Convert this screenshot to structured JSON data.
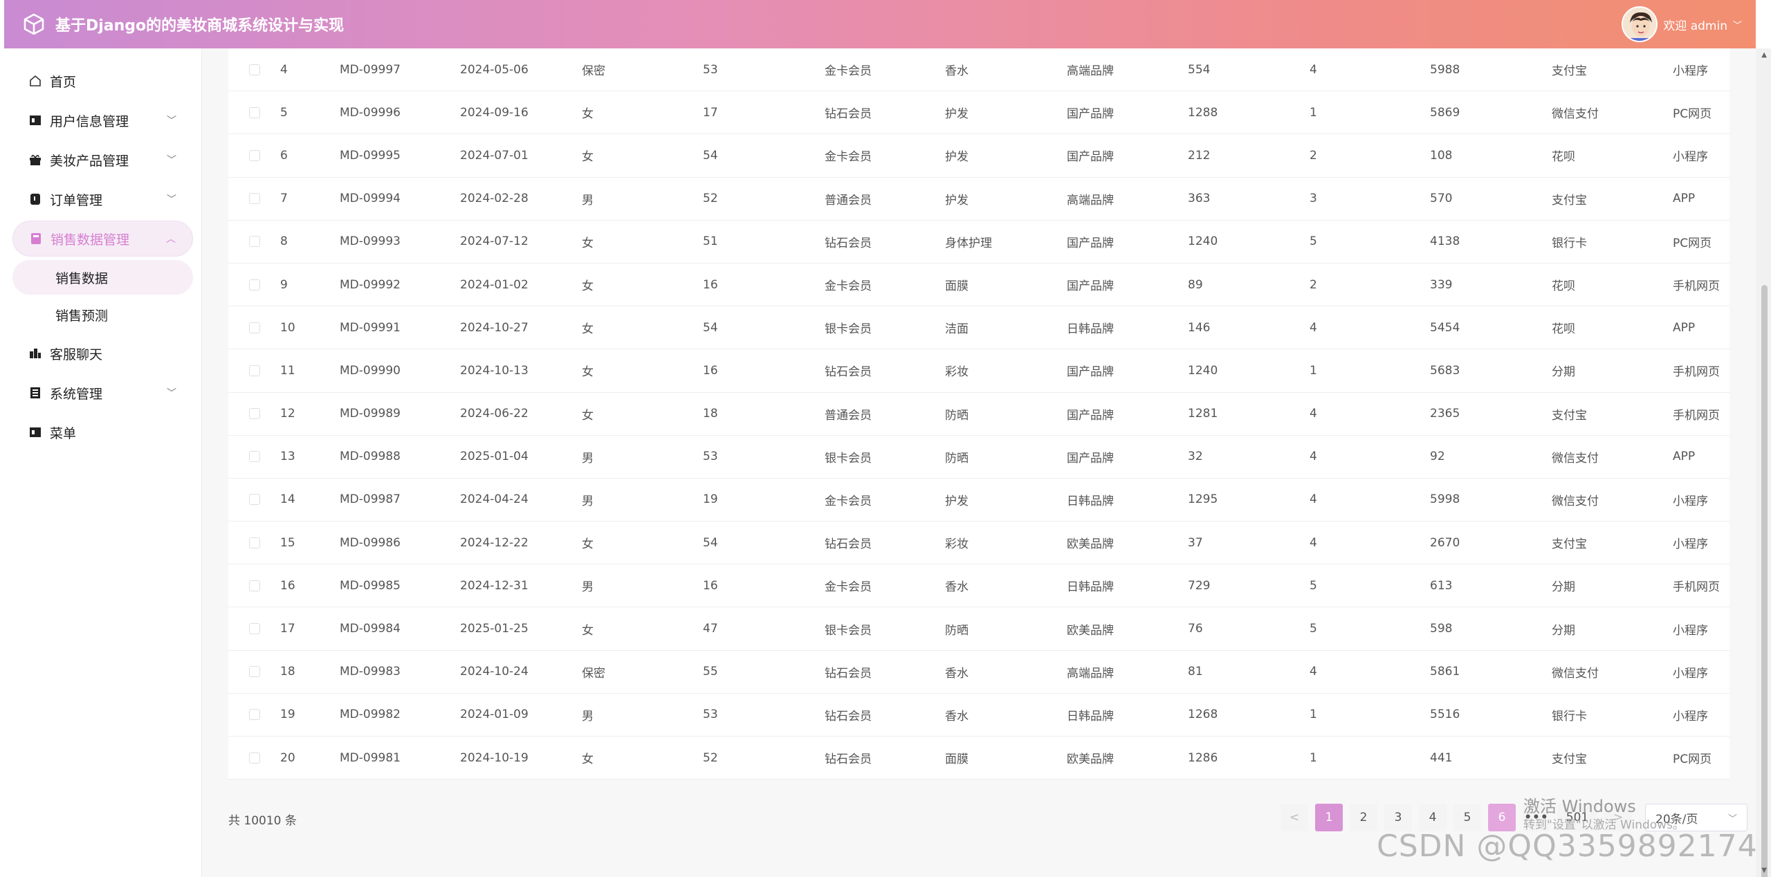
{
  "header": {
    "title": "基于Django的的美妆商城系统设计与实现",
    "welcome": "欢迎 admin"
  },
  "sidebar": {
    "items": [
      {
        "label": "首页",
        "icon": "home-icon",
        "chevron": ""
      },
      {
        "label": "用户信息管理",
        "icon": "user-card-icon",
        "chevron": "﹀"
      },
      {
        "label": "美妆产品管理",
        "icon": "gift-icon",
        "chevron": "﹀"
      },
      {
        "label": "订单管理",
        "icon": "order-icon",
        "chevron": "﹀"
      },
      {
        "label": "销售数据管理",
        "icon": "book-icon",
        "chevron": "︿"
      },
      {
        "label": "销售数据",
        "sub": true
      },
      {
        "label": "销售预测",
        "sub": true
      },
      {
        "label": "客服聊天",
        "icon": "chat-icon",
        "chevron": ""
      },
      {
        "label": "系统管理",
        "icon": "system-icon",
        "chevron": "﹀"
      },
      {
        "label": "菜单",
        "icon": "menu-icon",
        "chevron": ""
      }
    ]
  },
  "table": {
    "rows": [
      [
        "4",
        "MD-09997",
        "2024-05-06",
        "保密",
        "53",
        "金卡会员",
        "香水",
        "高端品牌",
        "554",
        "4",
        "5988",
        "支付宝",
        "小程序"
      ],
      [
        "5",
        "MD-09996",
        "2024-09-16",
        "女",
        "17",
        "钻石会员",
        "护发",
        "国产品牌",
        "1288",
        "1",
        "5869",
        "微信支付",
        "PC网页"
      ],
      [
        "6",
        "MD-09995",
        "2024-07-01",
        "女",
        "54",
        "金卡会员",
        "护发",
        "国产品牌",
        "212",
        "2",
        "108",
        "花呗",
        "小程序"
      ],
      [
        "7",
        "MD-09994",
        "2024-02-28",
        "男",
        "52",
        "普通会员",
        "护发",
        "高端品牌",
        "363",
        "3",
        "570",
        "支付宝",
        "APP"
      ],
      [
        "8",
        "MD-09993",
        "2024-07-12",
        "女",
        "51",
        "钻石会员",
        "身体护理",
        "国产品牌",
        "1240",
        "5",
        "4138",
        "银行卡",
        "PC网页"
      ],
      [
        "9",
        "MD-09992",
        "2024-01-02",
        "女",
        "16",
        "金卡会员",
        "面膜",
        "国产品牌",
        "89",
        "2",
        "339",
        "花呗",
        "手机网页"
      ],
      [
        "10",
        "MD-09991",
        "2024-10-27",
        "女",
        "54",
        "银卡会员",
        "洁面",
        "日韩品牌",
        "146",
        "4",
        "5454",
        "花呗",
        "APP"
      ],
      [
        "11",
        "MD-09990",
        "2024-10-13",
        "女",
        "16",
        "钻石会员",
        "彩妆",
        "国产品牌",
        "1240",
        "1",
        "5683",
        "分期",
        "手机网页"
      ],
      [
        "12",
        "MD-09989",
        "2024-06-22",
        "女",
        "18",
        "普通会员",
        "防晒",
        "国产品牌",
        "1281",
        "4",
        "2365",
        "支付宝",
        "手机网页"
      ],
      [
        "13",
        "MD-09988",
        "2025-01-04",
        "男",
        "53",
        "银卡会员",
        "防晒",
        "国产品牌",
        "32",
        "4",
        "92",
        "微信支付",
        "APP"
      ],
      [
        "14",
        "MD-09987",
        "2024-04-24",
        "男",
        "19",
        "金卡会员",
        "护发",
        "日韩品牌",
        "1295",
        "4",
        "5998",
        "微信支付",
        "小程序"
      ],
      [
        "15",
        "MD-09986",
        "2024-12-22",
        "女",
        "54",
        "钻石会员",
        "彩妆",
        "欧美品牌",
        "37",
        "4",
        "2670",
        "支付宝",
        "小程序"
      ],
      [
        "16",
        "MD-09985",
        "2024-12-31",
        "男",
        "16",
        "金卡会员",
        "香水",
        "日韩品牌",
        "729",
        "5",
        "613",
        "分期",
        "手机网页"
      ],
      [
        "17",
        "MD-09984",
        "2025-01-25",
        "女",
        "47",
        "银卡会员",
        "防晒",
        "欧美品牌",
        "76",
        "5",
        "598",
        "分期",
        "小程序"
      ],
      [
        "18",
        "MD-09983",
        "2024-10-24",
        "保密",
        "55",
        "钻石会员",
        "香水",
        "高端品牌",
        "81",
        "4",
        "5861",
        "微信支付",
        "小程序"
      ],
      [
        "19",
        "MD-09982",
        "2024-01-09",
        "男",
        "53",
        "钻石会员",
        "香水",
        "日韩品牌",
        "1268",
        "1",
        "5516",
        "银行卡",
        "小程序"
      ],
      [
        "20",
        "MD-09981",
        "2024-10-19",
        "女",
        "52",
        "钻石会员",
        "面膜",
        "欧美品牌",
        "1286",
        "1",
        "441",
        "支付宝",
        "PC网页"
      ]
    ]
  },
  "pagination": {
    "total": "共 10010 条",
    "prev": "<",
    "pages": [
      "1",
      "2",
      "3",
      "4",
      "5",
      "6"
    ],
    "more": "•••",
    "last": "501",
    "next": ">",
    "page_size": "20条/页",
    "active_page": "1",
    "hover_page": "6"
  },
  "overlay": {
    "activate_windows": "激活 Windows",
    "activate_hint": "转到\"设置\"以激活 Windows。",
    "csdn": "CSDN @QQ3359892174"
  },
  "colors": {
    "accent": "#d893d4",
    "header_start": "#c98bd2",
    "header_end": "#f28f70"
  }
}
